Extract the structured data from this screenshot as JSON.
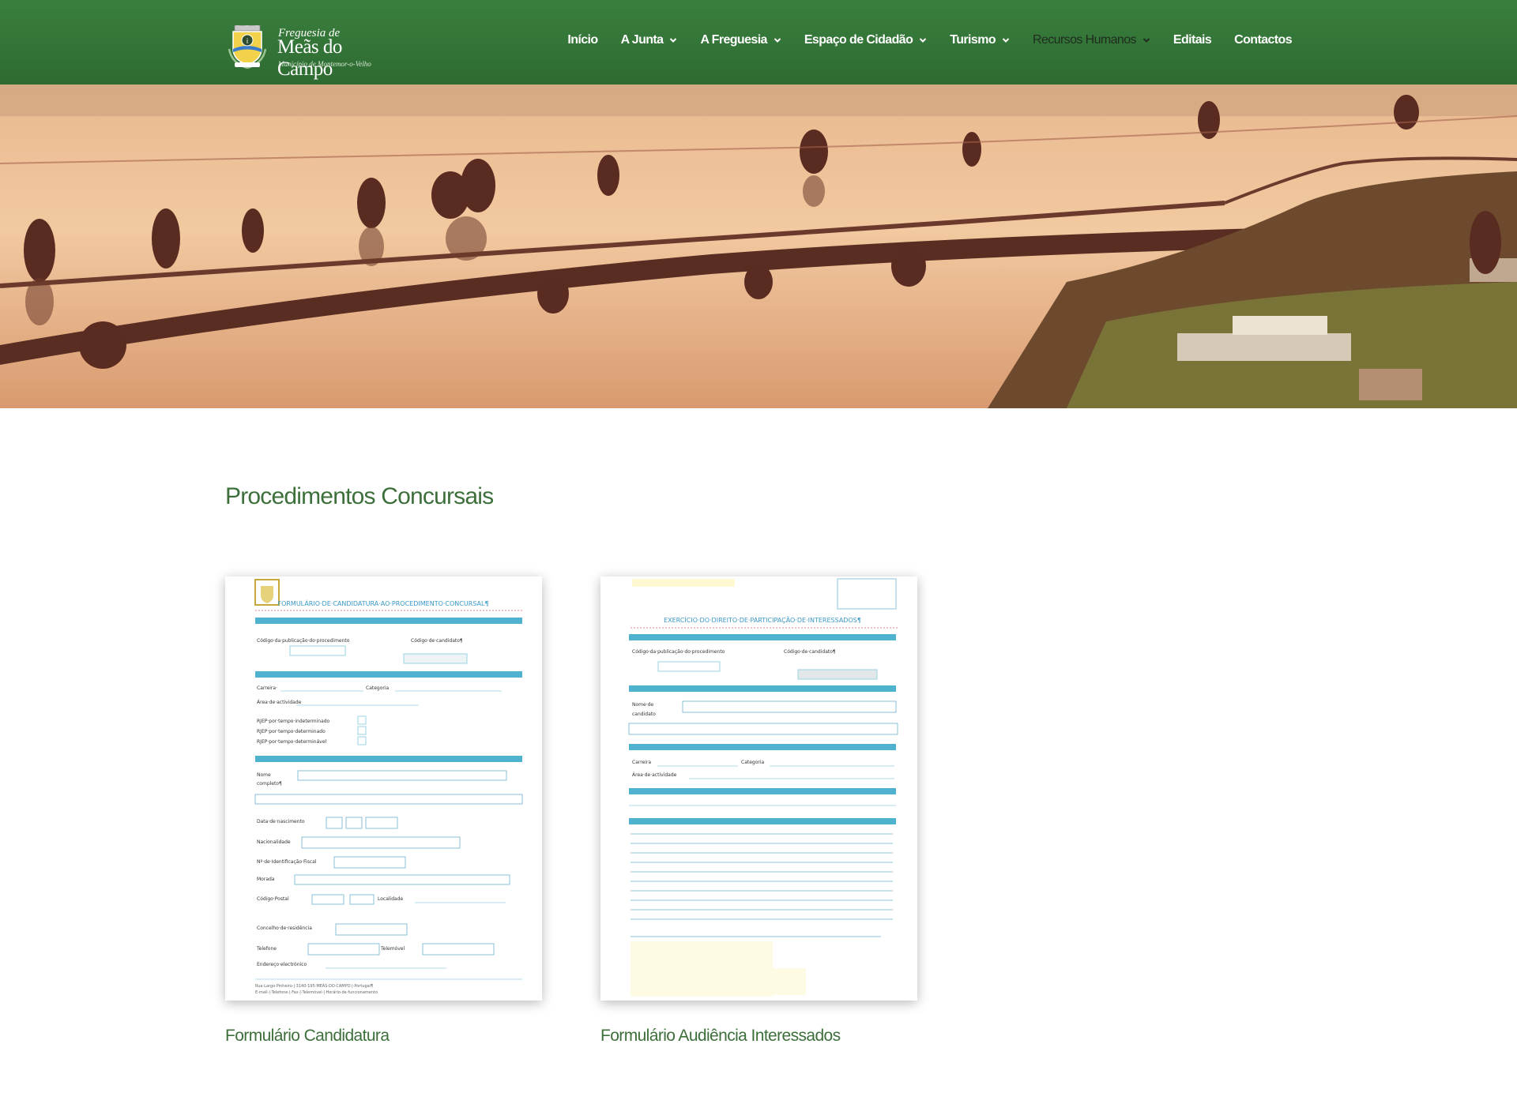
{
  "header": {
    "logo": {
      "pre": "Freguesia de",
      "main": "Meãs do Campo",
      "sub": "Município de Montemor-o-Velho"
    },
    "nav": [
      {
        "label": "Início",
        "dropdown": false
      },
      {
        "label": "A Junta",
        "dropdown": true
      },
      {
        "label": "A Freguesia",
        "dropdown": true
      },
      {
        "label": "Espaço de Cidadão",
        "dropdown": true
      },
      {
        "label": "Turismo",
        "dropdown": true
      },
      {
        "label": "Recursos Humanos",
        "dropdown": true,
        "active": true
      },
      {
        "label": "Editais",
        "dropdown": false
      },
      {
        "label": "Contactos",
        "dropdown": false
      }
    ]
  },
  "main": {
    "title": "Procedimentos Concursais",
    "cards": [
      {
        "title": "Formulário Candidatura",
        "doc_heading": "FORMULÁRIO·DE·CANDIDATURA·AO·PROCEDIMENTO·CONCURSAL¶"
      },
      {
        "title": "Formulário Audiência Interessados",
        "doc_heading": "EXERCÍCIO·DO·DIREITO·DE·PARTICIPAÇÃO·DE·INTERESSADOS¶"
      }
    ]
  },
  "colors": {
    "header_green": "#2e6b32",
    "title_green": "#3d6f3b",
    "doc_bar": "#4fb3cf"
  }
}
